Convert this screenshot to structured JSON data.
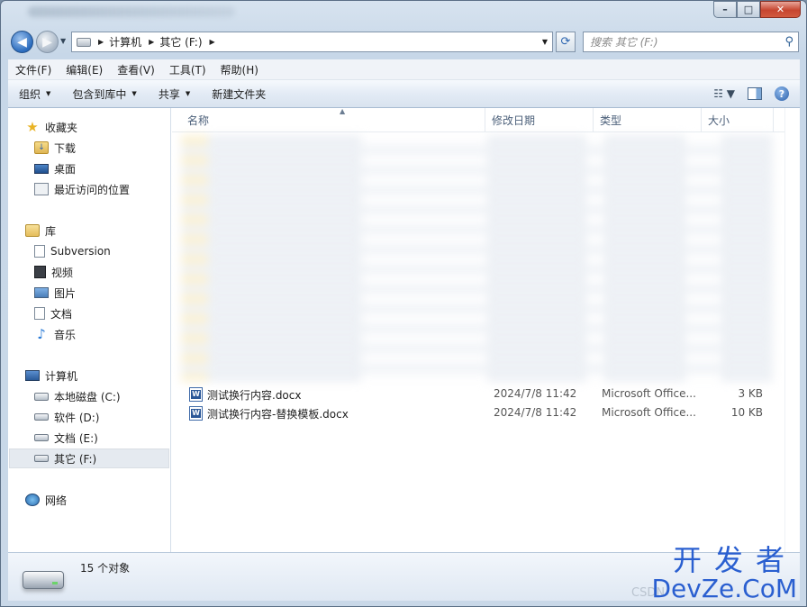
{
  "address": {
    "parts": [
      "计算机",
      "其它 (F:)"
    ]
  },
  "search": {
    "placeholder": "搜索 其它 (F:)"
  },
  "menu": [
    "文件(F)",
    "编辑(E)",
    "查看(V)",
    "工具(T)",
    "帮助(H)"
  ],
  "commands": [
    "组织",
    "包含到库中",
    "共享",
    "新建文件夹"
  ],
  "nav": {
    "favorites_label": "收藏夹",
    "favorites": [
      "下载",
      "桌面",
      "最近访问的位置"
    ],
    "libraries_label": "库",
    "libraries": [
      "Subversion",
      "视频",
      "图片",
      "文档",
      "音乐"
    ],
    "computer_label": "计算机",
    "drives": [
      "本地磁盘 (C:)",
      "软件 (D:)",
      "文档 (E:)",
      "其它 (F:)"
    ],
    "network_label": "网络"
  },
  "columns": [
    "名称",
    "修改日期",
    "类型",
    "大小"
  ],
  "files": [
    {
      "name": "测试换行内容.docx",
      "date": "2024/7/8 11:42",
      "type": "Microsoft Office...",
      "size": "3 KB"
    },
    {
      "name": "测试换行内容-替换模板.docx",
      "date": "2024/7/8 11:42",
      "type": "Microsoft Office...",
      "size": "10 KB"
    }
  ],
  "status": {
    "count": "15 个对象"
  },
  "watermark": {
    "top": "开发者",
    "bottom": "DevZe.CoM",
    "csdn": "CSDN"
  }
}
